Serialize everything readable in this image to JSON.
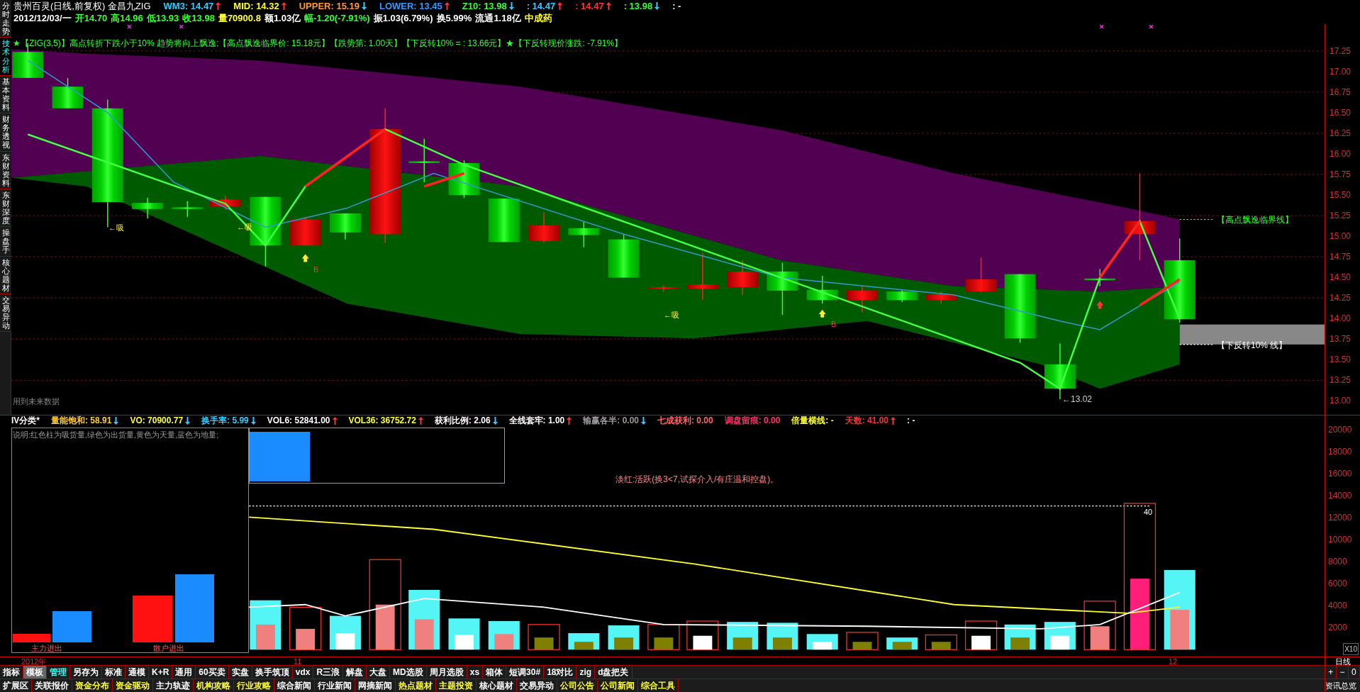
{
  "side_tabs": [
    {
      "label": "分时走势",
      "selected": false
    },
    {
      "label": "技术分析",
      "selected": true
    },
    {
      "label": "基本资料",
      "selected": false
    },
    {
      "label": "财务透视",
      "selected": false
    },
    {
      "label": "东财资料",
      "selected": false
    },
    {
      "label": "东财深度",
      "selected": false
    },
    {
      "label": "操盘手",
      "selected": false
    },
    {
      "label": "核心题材",
      "selected": false
    },
    {
      "label": "交易异动",
      "selected": false
    }
  ],
  "header": {
    "title": "贵州百灵(日线,前复权) 金昌九ZIG",
    "indicators": [
      {
        "label": "WM3: 14.47",
        "rising": true,
        "color": "#33ccff"
      },
      {
        "label": "MID: 14.32",
        "rising": true,
        "color": "#ffff33"
      },
      {
        "label": "UPPER: 15.19",
        "rising": false,
        "color": "#ff9933"
      },
      {
        "label": "LOWER: 13.45",
        "rising": true,
        "color": "#3399ff"
      },
      {
        "label": "Z10: 13.98",
        "rising": false,
        "color": "#33ff33"
      },
      {
        "label": ": 14.47",
        "rising": true,
        "color": "#33ccff"
      },
      {
        "label": ": 14.47",
        "rising": true,
        "color": "#ff3333"
      },
      {
        "label": ": 13.98",
        "rising": false,
        "color": "#33ff33"
      },
      {
        "label": ": -",
        "color": "#ffffff"
      }
    ],
    "quote": [
      {
        "text": "2012/12/03/一",
        "color": "#ffffff"
      },
      {
        "text": "开14.70",
        "color": "#33ff33"
      },
      {
        "text": "高14.96",
        "color": "#33ff33"
      },
      {
        "text": "低13.93",
        "color": "#33ff33"
      },
      {
        "text": "收13.98",
        "color": "#33ff33"
      },
      {
        "text": "量70900.8",
        "color": "#ffff33"
      },
      {
        "text": "额1.03亿",
        "color": "#ffffff"
      },
      {
        "text": "幅-1.20(-7.91%)",
        "color": "#33ff33"
      },
      {
        "text": "振1.03(6.79%)",
        "color": "#ffffff"
      },
      {
        "text": "换5.99%",
        "color": "#ffffff"
      },
      {
        "text": "流通1.18亿",
        "color": "#ffffff"
      },
      {
        "text": "中成药",
        "color": "#ffff33"
      }
    ]
  },
  "price_chart": {
    "signal_line": "★【ZIG(3,5)】高点转折下跌小于10% 趋势将向上飘逸:【高点飘逸临界价: 15.18元】【跌势第: 1.00天】【下反转10% = : 13.66元】★【下反转现价涨跌: -7.91%】",
    "absorb_labels": [
      "←吸",
      "←吸",
      "←吸"
    ],
    "buy_labels": [
      "B",
      "B"
    ],
    "low_label": "←13.02",
    "upper_line_label": "【高点飘逸临界线】",
    "reversal_line_label": "【下反转10% 线】",
    "future_data_note": "用到未来数据",
    "axis_ticks": [
      "17.25",
      "17.00",
      "16.75",
      "16.50",
      "16.25",
      "16.00",
      "15.75",
      "15.50",
      "15.25",
      "15.00",
      "14.75",
      "14.50",
      "14.25",
      "14.00",
      "13.75",
      "13.50",
      "13.25",
      "13.00"
    ]
  },
  "volume_panel": {
    "indicators": [
      {
        "label": "IV分类*",
        "color": "#ffffff"
      },
      {
        "label": "量能饱和: 58.91",
        "rising": false,
        "color": "#ffcc33"
      },
      {
        "label": "VO: 70900.77",
        "rising": false,
        "color": "#ffff33"
      },
      {
        "label": "换手率: 5.99",
        "rising": false,
        "color": "#33ccff"
      },
      {
        "label": "VOL6: 52841.00",
        "rising": true,
        "color": "#ffffff"
      },
      {
        "label": "VOL36: 36752.72",
        "rising": true,
        "color": "#ffff33"
      },
      {
        "label": "获利比例: 2.06",
        "rising": false,
        "color": "#ffffff"
      },
      {
        "label": "全线套牢: 1.00",
        "rising": true,
        "color": "#ffffff"
      },
      {
        "label": "输赢各半: 0.00",
        "rising": false,
        "color": "#999999"
      },
      {
        "label": "七成获利: 0.00",
        "color": "#ff6666"
      },
      {
        "label": "调盘留痕: 0.00",
        "color": "#ff3366"
      },
      {
        "label": "倍量横线: -",
        "color": "#ffff33"
      },
      {
        "label": "天数: 41.00",
        "rising": true,
        "color": "#ff3333"
      },
      {
        "label": ": -",
        "color": "#ffffff"
      }
    ],
    "legend_text": "说明:红色柱为吸货量,绿色为出货量,黄色为天量,蓝色为地量;",
    "legend_labels": [
      "主力进出",
      "散户进出"
    ],
    "status_text": "淡红:活跃(换3<7,试探介入/有庄温和控盘)。",
    "peak_label": "40",
    "axis_ticks": [
      "20000",
      "18000",
      "16000",
      "14000",
      "12000",
      "10000",
      "8000",
      "6000",
      "4000",
      "2000"
    ],
    "axis_multiplier": "X10"
  },
  "date_axis": {
    "labels": [
      "2012年",
      "11",
      "12"
    ],
    "period": "日线"
  },
  "toolbar_tabs": [
    {
      "label": "指标",
      "color": "#ffffff",
      "selected": false
    },
    {
      "label": "模板",
      "color": "#ffffff",
      "selected": true
    },
    {
      "label": "管理",
      "color": "#33ffff",
      "selected": false
    },
    {
      "label": "另存为",
      "color": "#ffffff",
      "selected": false
    },
    {
      "label": "标准",
      "color": "#ffffff",
      "selected": false
    },
    {
      "label": "通模",
      "color": "#ffffff",
      "selected": false
    },
    {
      "label": "K+R",
      "color": "#ffffff",
      "selected": false
    },
    {
      "label": "通用",
      "color": "#ffffff",
      "selected": false
    },
    {
      "label": "60买卖",
      "color": "#ffffff",
      "selected": false
    },
    {
      "label": "实盘",
      "color": "#ffffff",
      "selected": false
    },
    {
      "label": "换手筑顶",
      "color": "#ffffff",
      "selected": false
    },
    {
      "label": "vdx",
      "color": "#ffffff",
      "selected": false
    },
    {
      "label": "R三浪",
      "color": "#ffffff",
      "selected": false
    },
    {
      "label": "解盘",
      "color": "#ffffff",
      "selected": false
    },
    {
      "label": "大盘",
      "color": "#ffffff",
      "selected": false
    },
    {
      "label": "MD选股",
      "color": "#ffffff",
      "selected": false
    },
    {
      "label": "周月选股",
      "color": "#ffffff",
      "selected": false
    },
    {
      "label": "xs",
      "color": "#ffffff",
      "selected": false
    },
    {
      "label": "箱体",
      "color": "#ffffff",
      "selected": false
    },
    {
      "label": "短调30#",
      "color": "#ffffff",
      "selected": false
    },
    {
      "label": "18对比",
      "color": "#ffffff",
      "selected": false
    },
    {
      "label": "zig",
      "color": "#ffffff",
      "selected": false
    },
    {
      "label": "d盘把关",
      "color": "#ffffff",
      "selected": false
    }
  ],
  "zoom_buttons": [
    "+",
    "−",
    "0"
  ],
  "info_tabs": [
    {
      "label": "扩展区",
      "color": "#ffffff"
    },
    {
      "label": "关联报价",
      "color": "#ffffff"
    },
    {
      "label": "资金分布",
      "color": "#ffff33"
    },
    {
      "label": "资金驱动",
      "color": "#ffff33"
    },
    {
      "label": "主力轨迹",
      "color": "#ffffff"
    },
    {
      "label": "机构攻略",
      "color": "#ffff33"
    },
    {
      "label": "行业攻略",
      "color": "#ffff33"
    },
    {
      "label": "综合新闻",
      "color": "#ffffff"
    },
    {
      "label": "行业新闻",
      "color": "#ffffff"
    },
    {
      "label": "网摘新闻",
      "color": "#ffffff"
    },
    {
      "label": "热点题材",
      "color": "#ffff33"
    },
    {
      "label": "主题投资",
      "color": "#ffff33"
    },
    {
      "label": "核心题材",
      "color": "#ffffff"
    },
    {
      "label": "交易异动",
      "color": "#ffffff"
    },
    {
      "label": "公司公告",
      "color": "#ffff33"
    },
    {
      "label": "公司新闻",
      "color": "#ffff33"
    },
    {
      "label": "综合工具",
      "color": "#ffff33"
    }
  ],
  "info_overview": "资讯总览"
}
